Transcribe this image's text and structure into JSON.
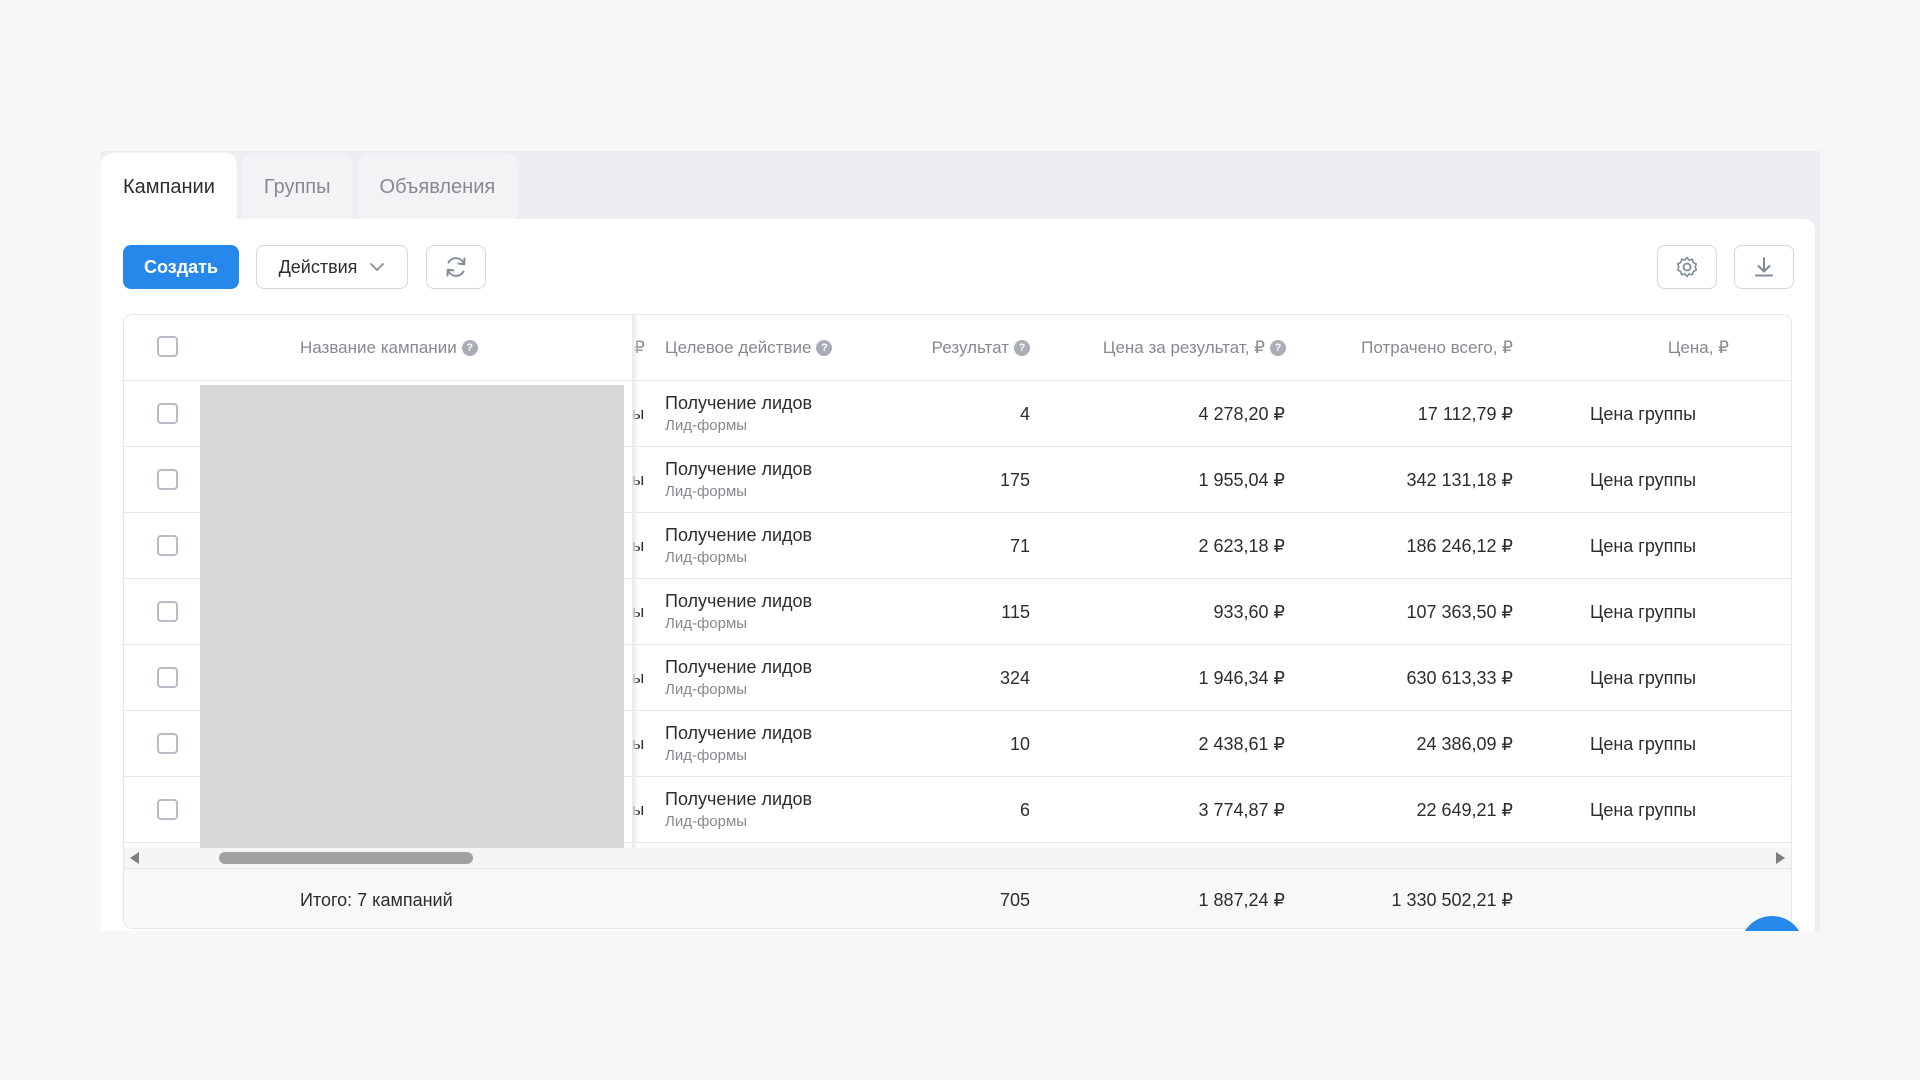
{
  "tabs": [
    {
      "label": "Кампании",
      "active": true
    },
    {
      "label": "Группы",
      "active": false
    },
    {
      "label": "Объявления",
      "active": false
    }
  ],
  "toolbar": {
    "create_label": "Создать",
    "actions_label": "Действия"
  },
  "table": {
    "headers": {
      "name": "Название кампании",
      "cut": "₽",
      "target": "Целевое действие",
      "result": "Результат",
      "price_per_result": "Цена за результат, ₽",
      "spent_total": "Потрачено всего, ₽",
      "price": "Цена, ₽"
    },
    "rows": [
      {
        "cut": "ы",
        "target": "Получение лидов",
        "target_sub": "Лид-формы",
        "result": "4",
        "price_per_result": "4 278,20 ₽",
        "spent_total": "17 112,79 ₽",
        "price": "Цена группы"
      },
      {
        "cut": "ы",
        "target": "Получение лидов",
        "target_sub": "Лид-формы",
        "result": "175",
        "price_per_result": "1 955,04 ₽",
        "spent_total": "342 131,18 ₽",
        "price": "Цена группы"
      },
      {
        "cut": "ы",
        "target": "Получение лидов",
        "target_sub": "Лид-формы",
        "result": "71",
        "price_per_result": "2 623,18 ₽",
        "spent_total": "186 246,12 ₽",
        "price": "Цена группы"
      },
      {
        "cut": "ы",
        "target": "Получение лидов",
        "target_sub": "Лид-формы",
        "result": "115",
        "price_per_result": "933,60 ₽",
        "spent_total": "107 363,50 ₽",
        "price": "Цена группы"
      },
      {
        "cut": "ы",
        "target": "Получение лидов",
        "target_sub": "Лид-формы",
        "result": "324",
        "price_per_result": "1 946,34 ₽",
        "spent_total": "630 613,33 ₽",
        "price": "Цена группы"
      },
      {
        "cut": "ы",
        "target": "Получение лидов",
        "target_sub": "Лид-формы",
        "result": "10",
        "price_per_result": "2 438,61 ₽",
        "spent_total": "24 386,09 ₽",
        "price": "Цена группы"
      },
      {
        "cut": "ы",
        "target": "Получение лидов",
        "target_sub": "Лид-формы",
        "result": "6",
        "price_per_result": "3 774,87 ₽",
        "spent_total": "22 649,21 ₽",
        "price": "Цена группы"
      }
    ],
    "footer": {
      "label": "Итого: 7 кампаний",
      "result": "705",
      "price_per_result": "1 887,24 ₽",
      "spent_total": "1 330 502,21 ₽"
    }
  },
  "colors": {
    "accent": "#2688eb",
    "text": "#2c2d2e",
    "muted": "#87898f",
    "redacted": "#d8d8d8"
  },
  "icons": {
    "refresh": "refresh-icon",
    "settings": "gear-icon",
    "download": "download-icon",
    "help": "question-icon",
    "dropdown": "chevron-down-icon"
  }
}
